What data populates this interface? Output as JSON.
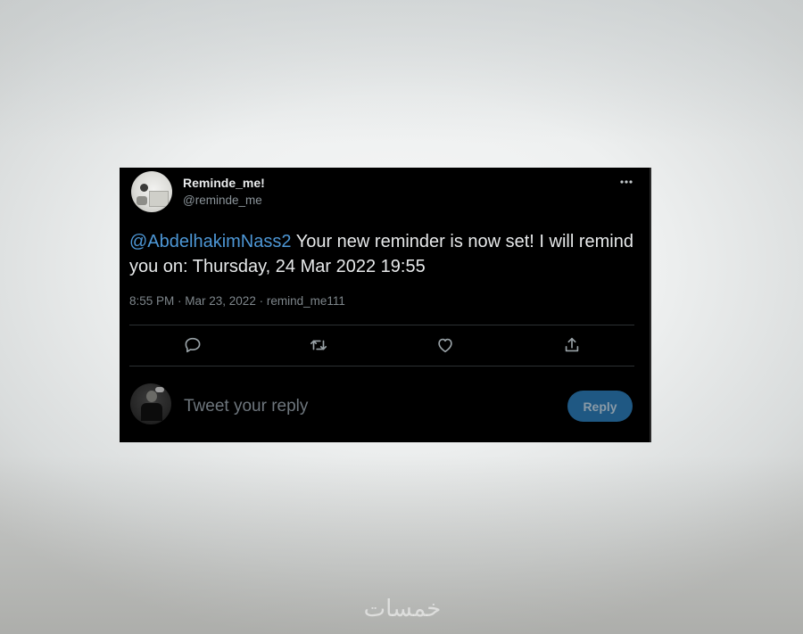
{
  "watermark": "خمسات",
  "tweet": {
    "author": {
      "display_name": "Reminde_me!",
      "handle": "@reminde_me"
    },
    "mention": "@AbdelhakimNass2",
    "body": " Your new reminder is now set! I will remind you on: Thursday, 24 Mar 2022 19:55",
    "meta": "8:55 PM · Mar 23, 2022 · remind_me111"
  },
  "icons": {
    "more": "more-horizontal-icon",
    "reply": "comment-icon",
    "retweet": "retweet-icon",
    "like": "heart-icon",
    "share": "share-icon"
  },
  "reply_box": {
    "placeholder": "Tweet your reply",
    "value": "",
    "button_label": "Reply"
  },
  "colors": {
    "card_background": "#000000",
    "mention": "#4d97d6",
    "reply_button": "#1f5883",
    "muted_text": "#7e868b"
  }
}
